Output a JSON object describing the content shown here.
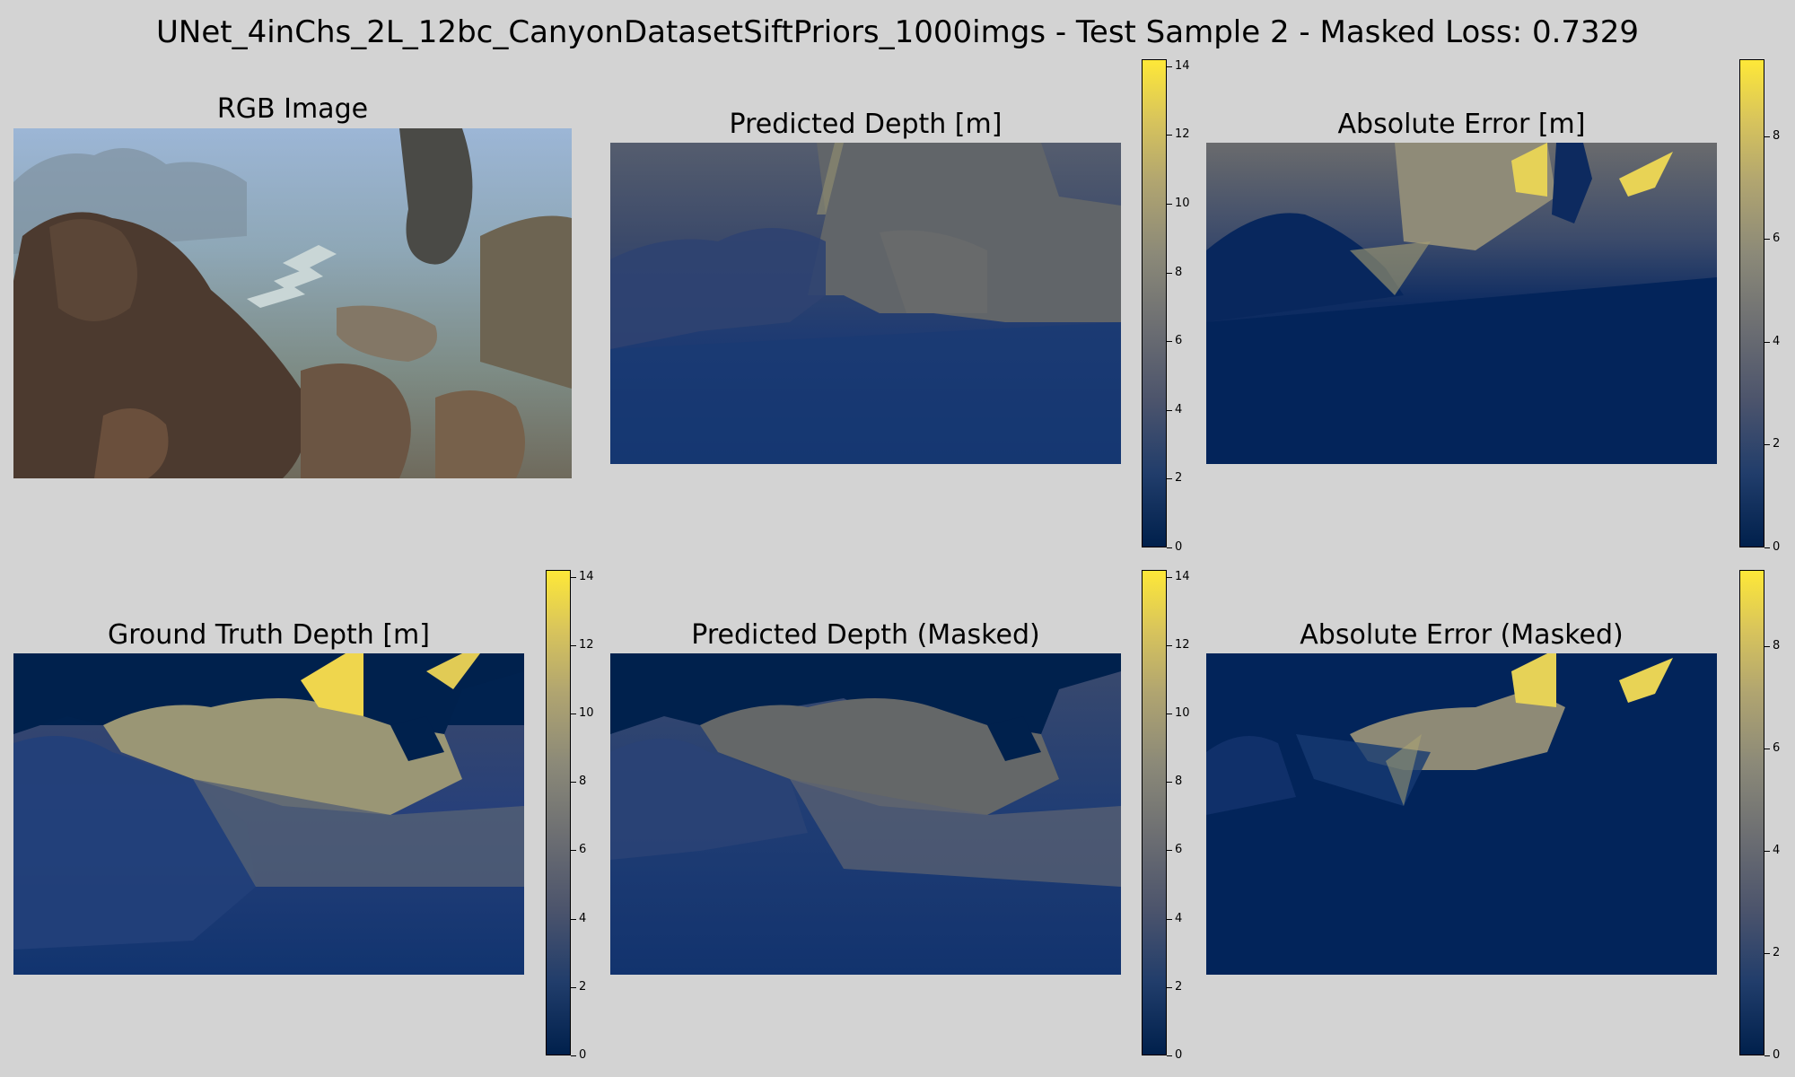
{
  "figure": {
    "suptitle": "UNet_4inChs_2L_12bc_CanyonDatasetSiftPriors_1000imgs - Test Sample 2 - Masked Loss: 0.7329"
  },
  "panels": {
    "rgb": {
      "title": "RGB Image"
    },
    "pred": {
      "title": "Predicted Depth [m]"
    },
    "err": {
      "title": "Absolute Error [m]"
    },
    "gt": {
      "title": "Ground Truth Depth [m]"
    },
    "pred_masked": {
      "title": "Predicted Depth (Masked)"
    },
    "err_masked": {
      "title": "Absolute Error (Masked)"
    }
  },
  "chart_data": [
    {
      "type": "heatmap",
      "title": "RGB Image",
      "content": "photo"
    },
    {
      "type": "heatmap",
      "title": "Predicted Depth [m]",
      "colormap": "cividis",
      "colorbar": {
        "min": 0,
        "max": 14.2,
        "ticks": [
          0,
          2,
          4,
          6,
          8,
          10,
          12,
          14
        ]
      }
    },
    {
      "type": "heatmap",
      "title": "Absolute Error [m]",
      "colormap": "cividis",
      "colorbar": {
        "min": 0,
        "max": 9.5,
        "ticks": [
          0,
          2,
          4,
          6,
          8
        ]
      }
    },
    {
      "type": "heatmap",
      "title": "Ground Truth Depth [m]",
      "colormap": "cividis",
      "colorbar": {
        "min": 0,
        "max": 14.2,
        "ticks": [
          0,
          2,
          4,
          6,
          8,
          10,
          12,
          14
        ]
      }
    },
    {
      "type": "heatmap",
      "title": "Predicted Depth (Masked)",
      "colormap": "cividis",
      "colorbar": {
        "min": 0,
        "max": 14.2,
        "ticks": [
          0,
          2,
          4,
          6,
          8,
          10,
          12,
          14
        ]
      }
    },
    {
      "type": "heatmap",
      "title": "Absolute Error (Masked)",
      "colormap": "cividis",
      "colorbar": {
        "min": 0,
        "max": 9.5,
        "ticks": [
          0,
          2,
          4,
          6,
          8
        ]
      }
    }
  ],
  "colors": {
    "background": "#d3d3d3",
    "cividis_low": "#00204c",
    "cividis_mid": "#7c7b78",
    "cividis_high": "#fee838"
  }
}
